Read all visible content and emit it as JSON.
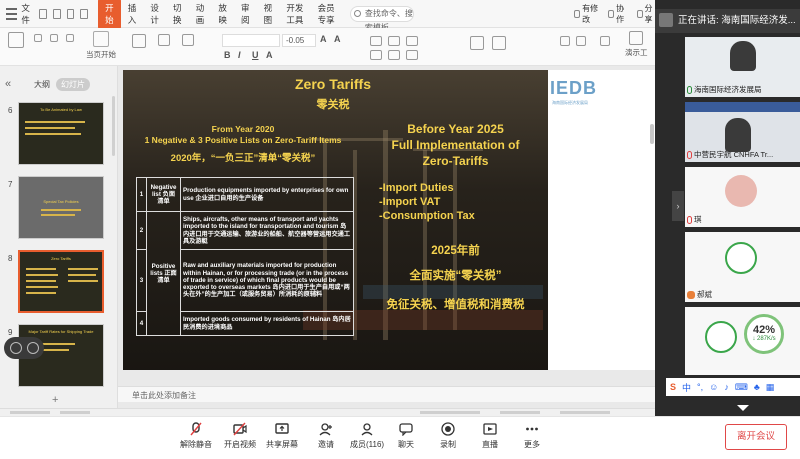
{
  "ribbon": {
    "file_label": "文件",
    "tabs": [
      "开始",
      "插入",
      "设计",
      "切换",
      "动画",
      "放映",
      "审阅",
      "视图",
      "开发工具",
      "会员专享"
    ],
    "active_tab": "开始",
    "search_placeholder": "查找命令、搜索模板",
    "right_items": [
      "有修改",
      "协作",
      "分享"
    ],
    "tools": [
      "当页开始"
    ],
    "font_size_value": "-0.05",
    "right_tool": "演示工"
  },
  "left_pane": {
    "view_outline": "大纲",
    "view_slides": "幻灯片",
    "thumbnails": [
      {
        "num": "6",
        "title": "To Be Animated by Law",
        "lines": 3
      },
      {
        "num": "7",
        "title": "Special Tax Policies",
        "lines": 4
      },
      {
        "num": "8",
        "title": "Zero Tariffs",
        "lines": 5,
        "selected": true
      },
      {
        "num": "9",
        "title": "Major Tariff Rates for Shipping Trade",
        "lines": 3
      }
    ]
  },
  "slide": {
    "title_en": "Zero Tariffs",
    "title_cn": "零关税",
    "left_heading_1": "From Year 2020",
    "left_heading_2": "1 Negative & 3 Positive Lists on Zero-Tariff Items",
    "left_heading_cn": "2020年，“一负三正”清单“零关税”",
    "right_heading_1": "Before Year 2025",
    "right_heading_2": "Full Implementation of",
    "right_heading_3": "Zero-Tariffs",
    "bullets": [
      "-Import Duties",
      "-Import VAT",
      "-Consumption Tax"
    ],
    "right_cn_1": "2025年前",
    "right_cn_2": "全面实施“零关税”",
    "right_cn_3": "免征关税、增值税和消费税",
    "logo": "IEDB",
    "logo_sub": "海南国际经济发展局",
    "table": {
      "rows": [
        {
          "num": "1",
          "type": "Negative list 负面清单",
          "text": "Production equipments imported by enterprises for own use 企业进口自用的生产设备"
        },
        {
          "num": "2",
          "type": "Positive lists 正面清单",
          "text": "Ships, aircrafts, other means of transport and yachts imported to the island for transportation and tourism 岛内进口用于交通运输、旅游业的船舶、航空器等营运用交通工具及游艇"
        },
        {
          "num": "3",
          "type": "",
          "text": "Raw and auxiliary materials imported for production within Hainan, or for processing trade (or in the process of trade in service) of which final products would be exported to overseas markets 岛内进口用于生产自用或“两头在外”的生产加工（或服务贸易）所消耗的原辅料"
        },
        {
          "num": "4",
          "type": "",
          "text": "Imported goods consumed by residents of Hainan 岛内居民消费的进境商品"
        }
      ]
    }
  },
  "notes_placeholder": "单击此处添加备注",
  "speaker": {
    "label": "正在讲话: 海南国际经济发..."
  },
  "participants": [
    {
      "name": "海南国际经济发展局",
      "kind": "video"
    },
    {
      "name": "中营民宇航 CNHFA Tr...",
      "kind": "video"
    },
    {
      "name": "琪",
      "kind": "avatar"
    },
    {
      "name": "郝斌",
      "kind": "logo"
    },
    {
      "name": "",
      "kind": "logo"
    }
  ],
  "network": {
    "percent": "42%",
    "speed": "↓ 287K/s"
  },
  "ime": {
    "label": "中"
  },
  "meeting_bar": {
    "buttons": [
      "解除静音",
      "开启视频",
      "共享屏幕",
      "邀请",
      "成员(116)",
      "聊天",
      "录制",
      "直播",
      "更多"
    ],
    "leave": "离开会议"
  },
  "colors": {
    "accent": "#e85d2e",
    "slide_title": "#f5d34f",
    "leave": "#e04848"
  }
}
